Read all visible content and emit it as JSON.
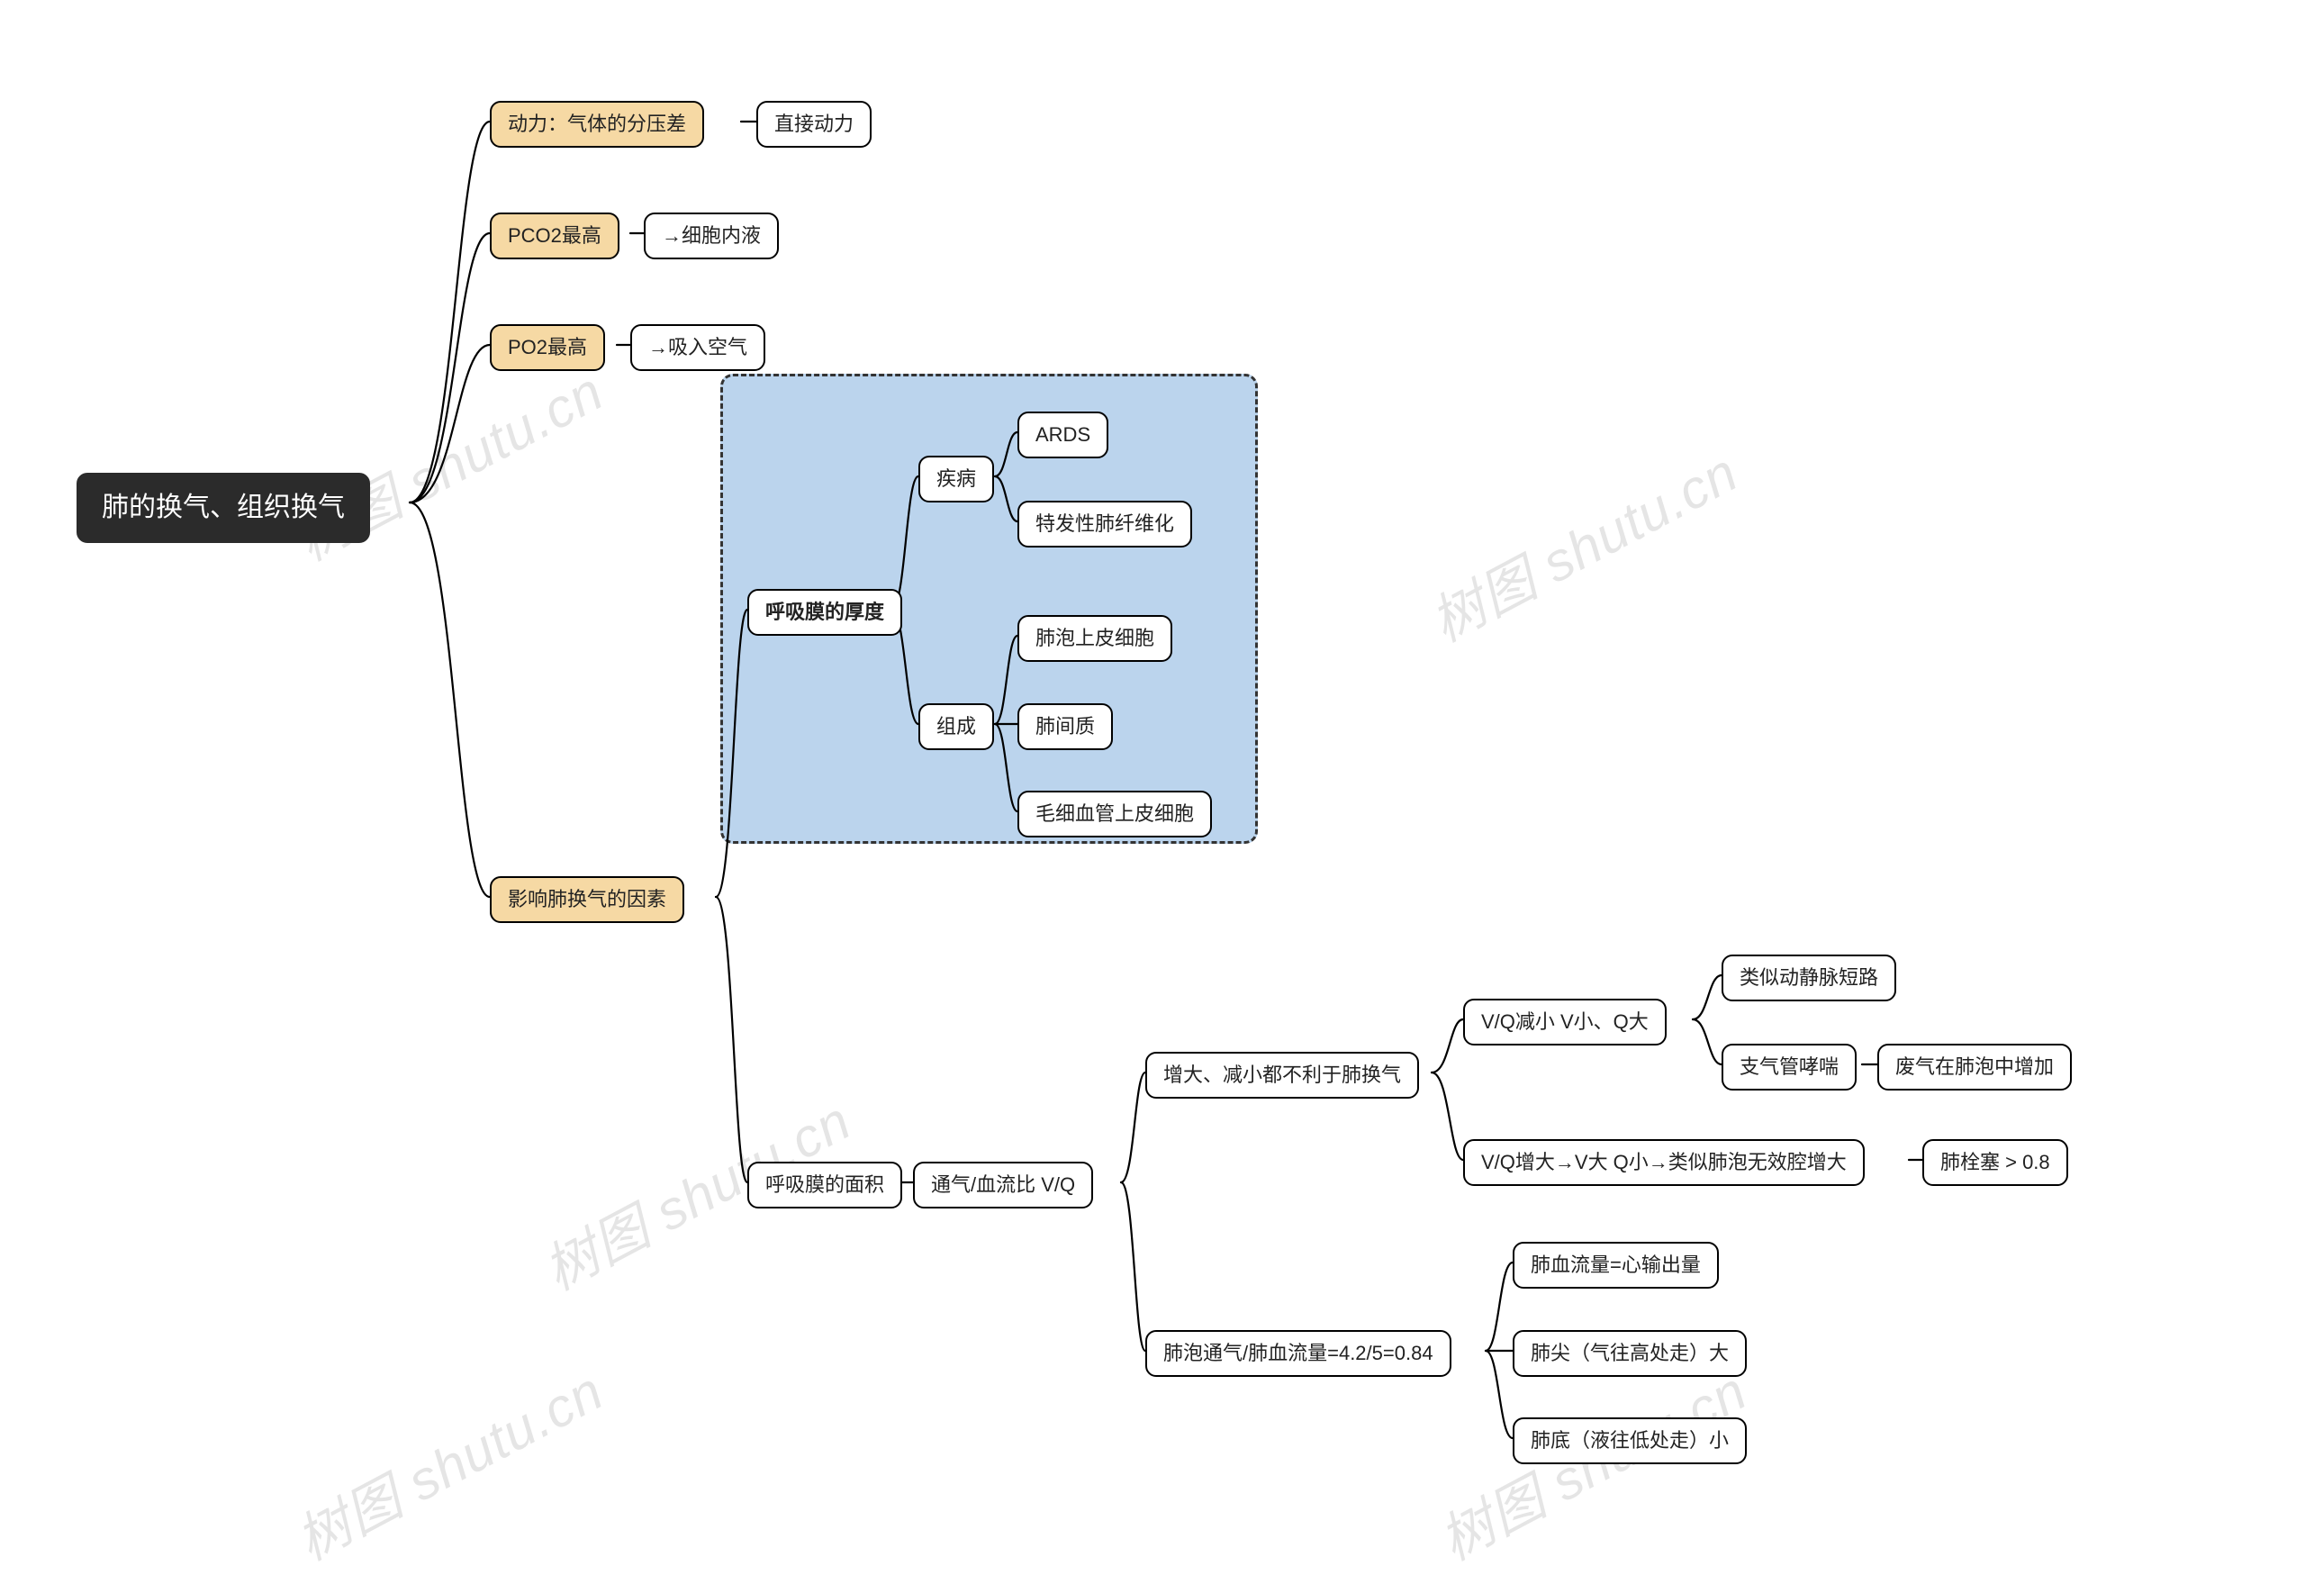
{
  "watermark": "树图 shutu.cn",
  "root": "肺的换气、组织换气",
  "l1": {
    "n1": "动力：气体的分压差",
    "n1c": "直接动力",
    "n2": "PCO2最高",
    "n2c": "→细胞内液",
    "n3": "PO2最高",
    "n3c": "→吸入空气",
    "n4": "影响肺换气的因素"
  },
  "thickness": {
    "label": "呼吸膜的厚度",
    "disease": "疾病",
    "d1": "ARDS",
    "d2": "特发性肺纤维化",
    "comp": "组成",
    "c1": "肺泡上皮细胞",
    "c2": "肺间质",
    "c3": "毛细血管上皮细胞"
  },
  "area": {
    "label": "呼吸膜的面积",
    "vq": "通气/血流比  V/Q",
    "change": "增大、减小都不利于肺换气",
    "vq_small": "V/Q减小  V小、Q大",
    "vq_small_c1": "类似动静脉短路",
    "vq_small_c2": "支气管哮喘",
    "vq_small_c2e": "废气在肺泡中增加",
    "vq_big": "V/Q增大→V大 Q小→类似肺泡无效腔增大",
    "vq_big_e": "肺栓塞 > 0.8",
    "formula": "肺泡通气/肺血流量=4.2/5=0.84",
    "f1": "肺血流量=心输出量",
    "f2": "肺尖（气往高处走）大",
    "f3": "肺底（液往低处走）小"
  }
}
